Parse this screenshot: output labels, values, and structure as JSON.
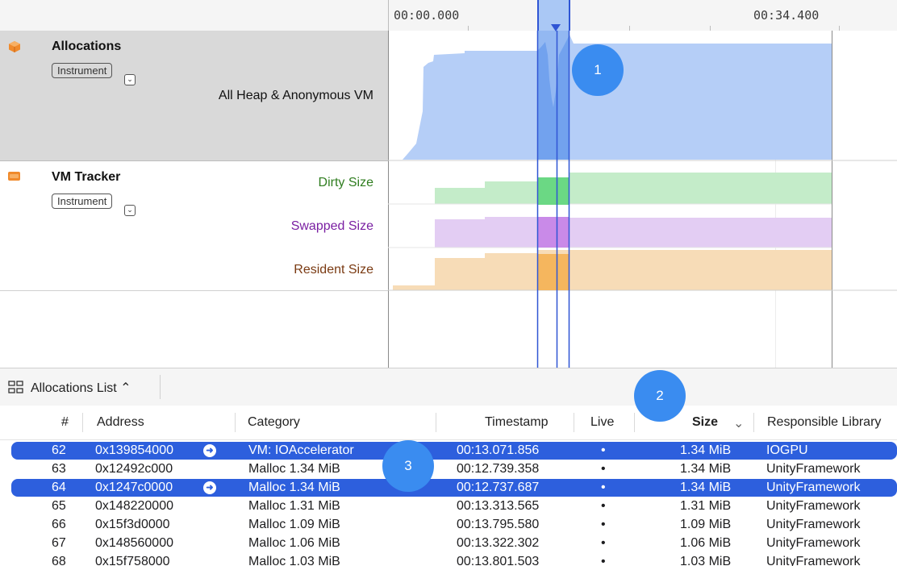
{
  "ruler": {
    "start_time": "00:00.000",
    "end_time": "00:34.400"
  },
  "tracks": {
    "allocations": {
      "icon": "orange-cube-icon",
      "title": "Allocations",
      "badge": "Instrument",
      "metric": "All Heap & Anonymous VM",
      "color": "#b5cef7"
    },
    "vm_tracker": {
      "icon": "orange-memory-chip-icon",
      "title": "VM Tracker",
      "badge": "Instrument",
      "metrics": [
        {
          "label": "Dirty Size",
          "color": "#2f7d1f",
          "fill": "#c4ecc9"
        },
        {
          "label": "Swapped Size",
          "color": "#7a1fa2",
          "fill": "#e3cdf3"
        },
        {
          "label": "Resident Size",
          "color": "#7a3a12",
          "fill": "#f7dcb7"
        }
      ]
    }
  },
  "toolbar": {
    "view_selector": "Allocations List ⌃"
  },
  "table": {
    "columns": [
      "#",
      "Address",
      "Category",
      "Timestamp",
      "Live",
      "Size",
      "Responsible Library"
    ],
    "sort_indicator": "⌄",
    "rows": [
      {
        "num": "62",
        "address": "0x139854000",
        "category": "VM: IOAccelerator",
        "timestamp": "00:13.071.856",
        "live": "•",
        "size": "1.34 MiB",
        "library": "IOGPU",
        "selected": true
      },
      {
        "num": "63",
        "address": "0x12492c000",
        "category": "Malloc 1.34 MiB",
        "timestamp": "00:12.739.358",
        "live": "•",
        "size": "1.34 MiB",
        "library": "UnityFramework",
        "selected": false
      },
      {
        "num": "64",
        "address": "0x1247c0000",
        "category": "Malloc 1.34 MiB",
        "timestamp": "00:12.737.687",
        "live": "•",
        "size": "1.34 MiB",
        "library": "UnityFramework",
        "selected": true
      },
      {
        "num": "65",
        "address": "0x148220000",
        "category": "Malloc 1.31 MiB",
        "timestamp": "00:13.313.565",
        "live": "•",
        "size": "1.31 MiB",
        "library": "UnityFramework",
        "selected": false
      },
      {
        "num": "66",
        "address": "0x15f3d0000",
        "category": "Malloc 1.09 MiB",
        "timestamp": "00:13.795.580",
        "live": "•",
        "size": "1.09 MiB",
        "library": "UnityFramework",
        "selected": false
      },
      {
        "num": "67",
        "address": "0x148560000",
        "category": "Malloc 1.06 MiB",
        "timestamp": "00:13.322.302",
        "live": "•",
        "size": "1.06 MiB",
        "library": "UnityFramework",
        "selected": false
      },
      {
        "num": "68",
        "address": "0x15f758000",
        "category": "Malloc 1.03 MiB",
        "timestamp": "00:13.801.503",
        "live": "•",
        "size": "1.03 MiB",
        "library": "UnityFramework",
        "selected": false
      }
    ]
  },
  "callouts": [
    "1",
    "2",
    "3"
  ],
  "colors": {
    "selection": "#2d5fdd",
    "callout": "#3a8cf0",
    "inspection_line": "#2f55d4"
  }
}
